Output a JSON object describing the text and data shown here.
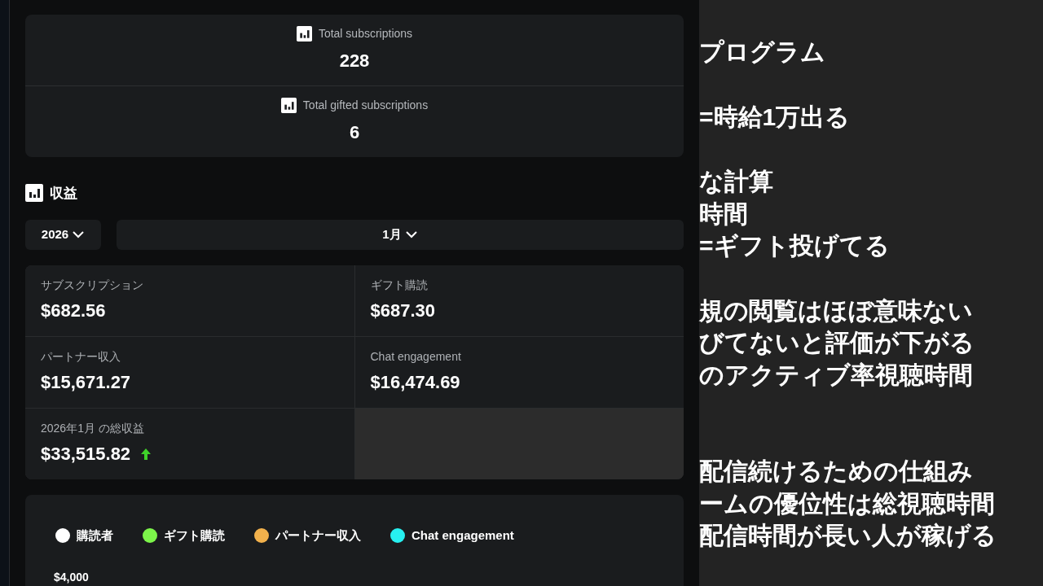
{
  "totals": [
    {
      "label": "Total subscriptions",
      "value": "228"
    },
    {
      "label": "Total gifted subscriptions",
      "value": "6"
    }
  ],
  "revenue": {
    "title": "収益",
    "year": "2026",
    "month": "1月",
    "cells": [
      {
        "label": "サブスクリプション",
        "value": "$682.56"
      },
      {
        "label": "ギフト購読",
        "value": "$687.30"
      },
      {
        "label": "パートナー収入",
        "value": "$15,671.27"
      },
      {
        "label": "Chat engagement",
        "value": "$16,474.69"
      },
      {
        "label": "2026年1月 の総収益",
        "value": "$33,515.82",
        "rising": true
      }
    ]
  },
  "chart": {
    "legend": [
      {
        "label": "購読者",
        "color": "#ffffff"
      },
      {
        "label": "ギフト購読",
        "color": "#7cf54a"
      },
      {
        "label": "パートナー収入",
        "color": "#f2b14c"
      },
      {
        "label": "Chat engagement",
        "color": "#27f0f0"
      }
    ],
    "top_tick": "$4,000"
  },
  "notes": [
    {
      "kind": "block",
      "lines": [
        "プログラム"
      ]
    },
    {
      "kind": "block",
      "lines": [
        "=時給1万出る"
      ]
    },
    {
      "kind": "block",
      "lines": [
        "な計算",
        "時間",
        "=ギフト投げてる"
      ]
    },
    {
      "kind": "block",
      "lines": [
        "規の閲覧はほぼ意味ない",
        "びてないと評価が下がる",
        "のアクティブ率視聴時間"
      ]
    },
    {
      "kind": "section",
      "lines": [
        "配信続けるための仕組み",
        "ームの優位性は総視聴時間",
        "配信時間が長い人が稼げる"
      ]
    }
  ]
}
